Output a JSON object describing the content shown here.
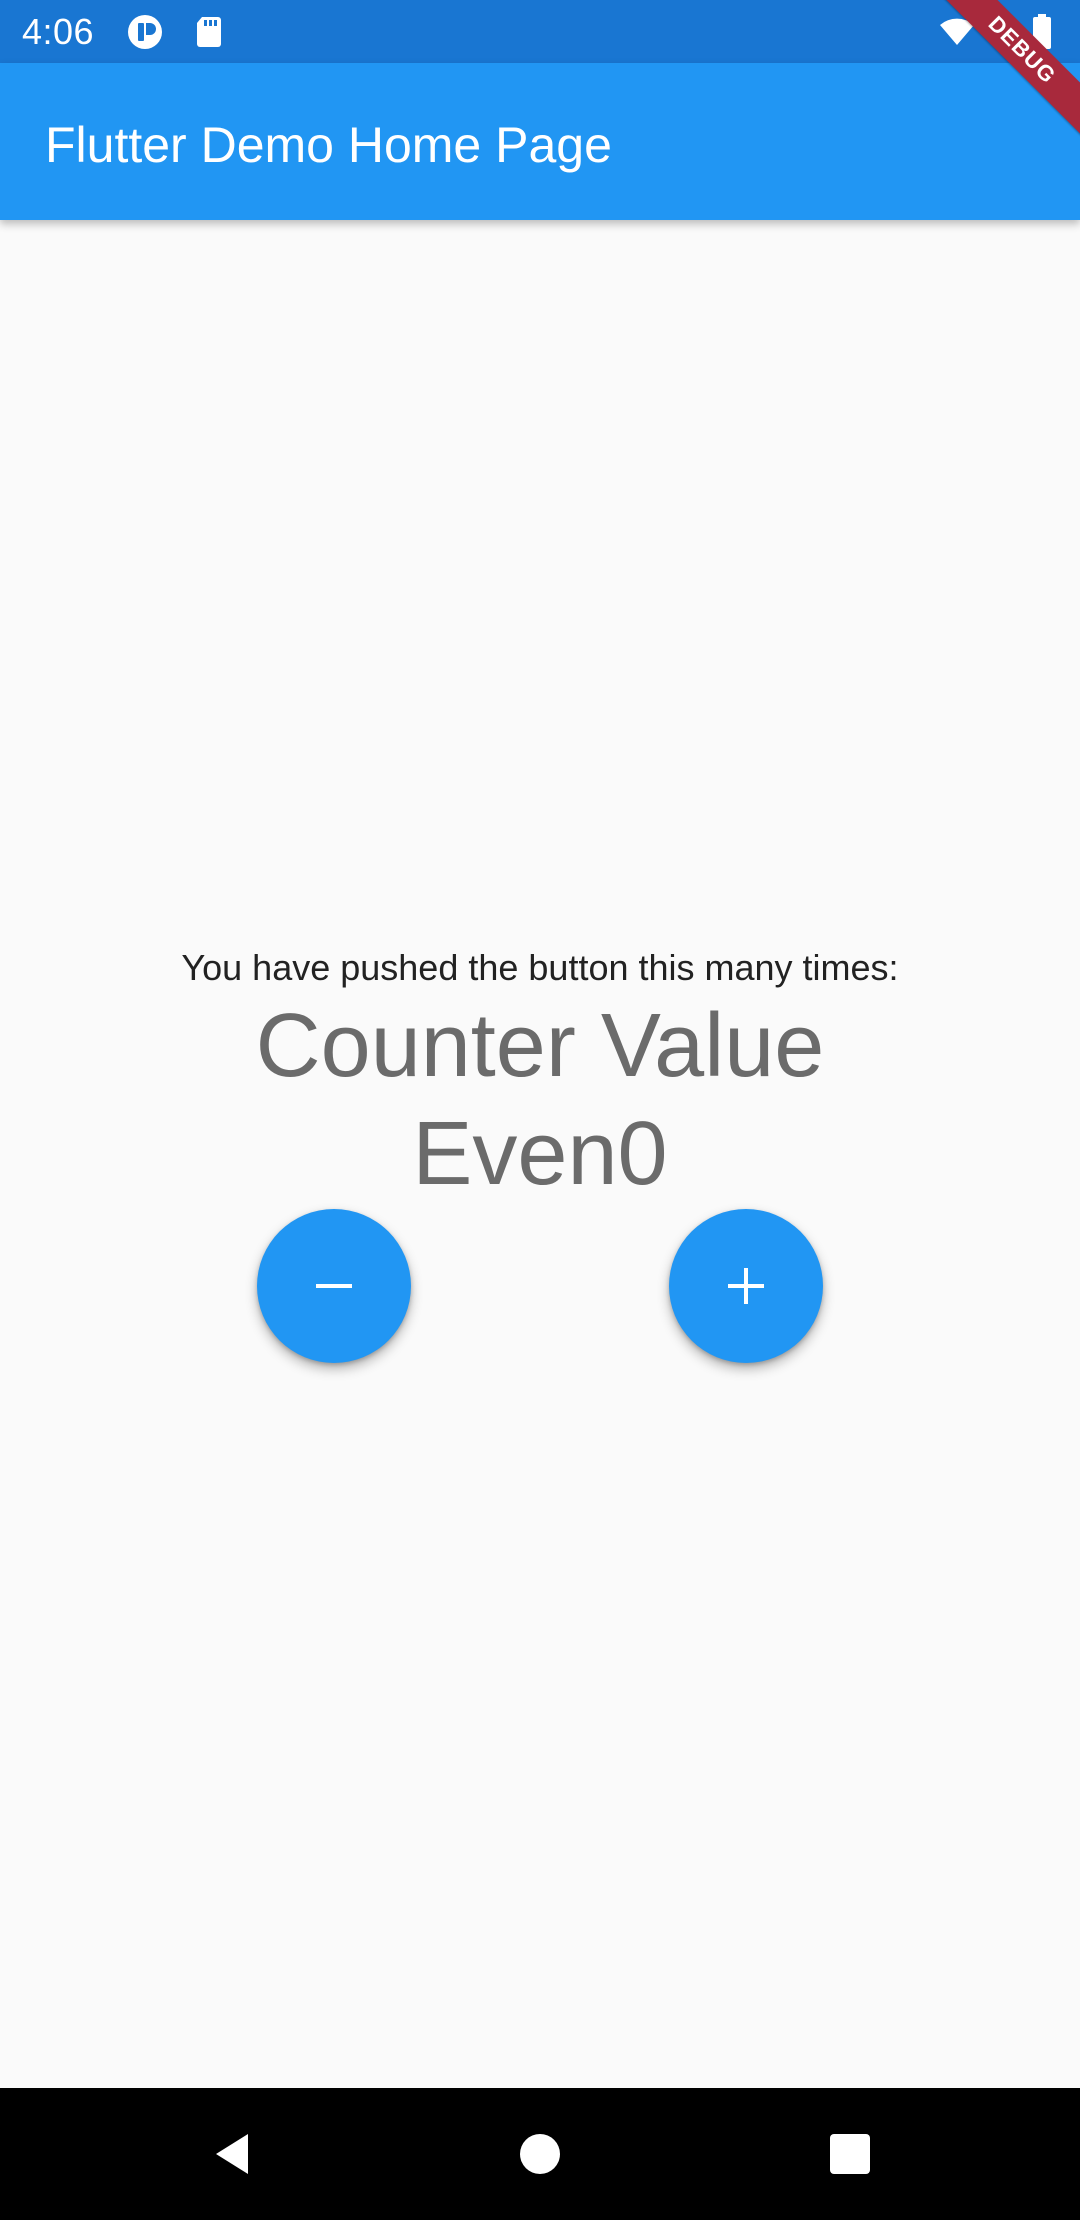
{
  "status_bar": {
    "time": "4:06",
    "icons": [
      "app-notification-icon",
      "sd-card-icon",
      "wifi-icon",
      "battery-icon"
    ],
    "background_color": "#1976d2"
  },
  "app_bar": {
    "title": "Flutter Demo Home Page",
    "background_color": "#2196f3"
  },
  "debug_banner": {
    "label": "DEBUG",
    "color": "#a8293c"
  },
  "main": {
    "prompt": "You have pushed the button this many times:",
    "counter_label": "Counter Value",
    "counter_value": "Even0"
  },
  "actions": {
    "decrement_icon": "minus-icon",
    "increment_icon": "plus-icon",
    "accent_color": "#2196f3"
  },
  "navigation_bar": {
    "buttons": [
      "back-icon",
      "home-icon",
      "recents-icon"
    ]
  }
}
